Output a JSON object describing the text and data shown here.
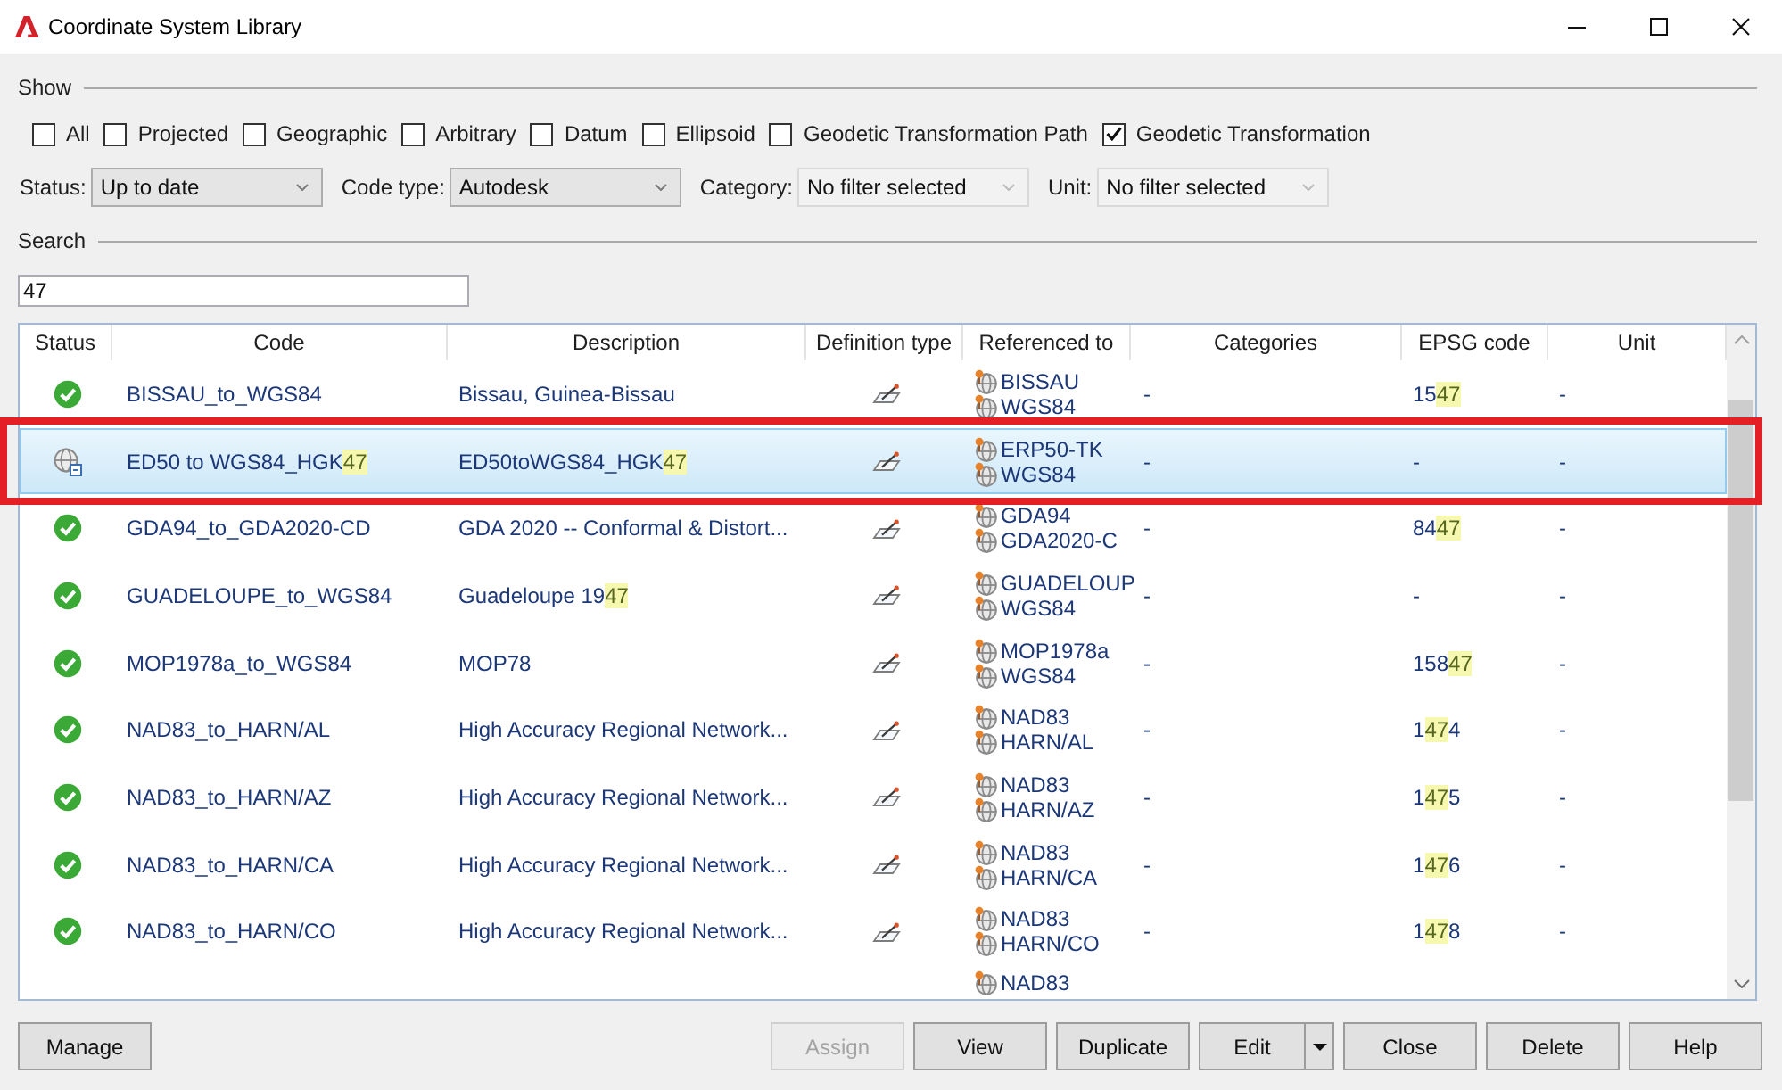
{
  "window": {
    "title": "Coordinate System Library"
  },
  "show": {
    "label": "Show",
    "options": [
      {
        "label": "All",
        "checked": false
      },
      {
        "label": "Projected",
        "checked": false
      },
      {
        "label": "Geographic",
        "checked": false
      },
      {
        "label": "Arbitrary",
        "checked": false
      },
      {
        "label": "Datum",
        "checked": false
      },
      {
        "label": "Ellipsoid",
        "checked": false
      },
      {
        "label": "Geodetic Transformation Path",
        "checked": false
      },
      {
        "label": "Geodetic Transformation",
        "checked": true
      }
    ]
  },
  "filters": [
    {
      "label": "Status:",
      "value": "Up to date",
      "disabled": false
    },
    {
      "label": "Code type:",
      "value": "Autodesk",
      "disabled": false
    },
    {
      "label": "Category:",
      "value": "No filter selected",
      "disabled": true
    },
    {
      "label": "Unit:",
      "value": "No filter selected",
      "disabled": true
    }
  ],
  "search": {
    "label": "Search",
    "value": "47"
  },
  "table": {
    "columns": [
      "Status",
      "Code",
      "Description",
      "Definition type",
      "Referenced to",
      "Categories",
      "EPSG code",
      "Unit"
    ],
    "rows": [
      {
        "status": {
          "kind": "valid"
        },
        "code": [
          {
            "text": "BISSAU_to_WGS84",
            "match": false
          }
        ],
        "description": [
          {
            "text": "Bissau, Guinea-Bissau",
            "match": false
          }
        ],
        "definition_type": {
          "kind": "transformation"
        },
        "referenced_to": [
          "BISSAU",
          "WGS84"
        ],
        "categories": "-",
        "epsg_code": [
          {
            "text": "15",
            "match": false
          },
          {
            "text": "47",
            "match": true
          }
        ],
        "unit": "-",
        "selected": false,
        "outlined": false
      },
      {
        "status": {
          "kind": "user"
        },
        "code": [
          {
            "text": "ED50 to WGS84_HGK",
            "match": false
          },
          {
            "text": "47",
            "match": true
          }
        ],
        "description": [
          {
            "text": "ED50toWGS84_HGK",
            "match": false
          },
          {
            "text": "47",
            "match": true
          }
        ],
        "definition_type": {
          "kind": "transformation"
        },
        "referenced_to": [
          "ERP50-TK",
          "WGS84"
        ],
        "categories": "-",
        "epsg_code": [
          {
            "text": "-",
            "match": false
          }
        ],
        "unit": "-",
        "selected": true,
        "outlined": true
      },
      {
        "status": {
          "kind": "valid"
        },
        "code": [
          {
            "text": "GDA94_to_GDA2020-CD",
            "match": false
          }
        ],
        "description": [
          {
            "text": "GDA 2020 -- Conformal & Distort...",
            "match": false
          }
        ],
        "definition_type": {
          "kind": "transformation"
        },
        "referenced_to": [
          "GDA94",
          "GDA2020-C"
        ],
        "categories": "-",
        "epsg_code": [
          {
            "text": "84",
            "match": false
          },
          {
            "text": "47",
            "match": true
          }
        ],
        "unit": "-",
        "selected": false,
        "outlined": false
      },
      {
        "status": {
          "kind": "valid"
        },
        "code": [
          {
            "text": "GUADELOUPE_to_WGS84",
            "match": false
          }
        ],
        "description": [
          {
            "text": "Guadeloupe 19",
            "match": false
          },
          {
            "text": "47",
            "match": true
          }
        ],
        "definition_type": {
          "kind": "transformation"
        },
        "referenced_to": [
          "GUADELOUP",
          "WGS84"
        ],
        "categories": "-",
        "epsg_code": [
          {
            "text": "-",
            "match": false
          }
        ],
        "unit": "-",
        "selected": false,
        "outlined": false
      },
      {
        "status": {
          "kind": "valid"
        },
        "code": [
          {
            "text": "MOP1978a_to_WGS84",
            "match": false
          }
        ],
        "description": [
          {
            "text": "MOP78",
            "match": false
          }
        ],
        "definition_type": {
          "kind": "transformation"
        },
        "referenced_to": [
          "MOP1978a",
          "WGS84"
        ],
        "categories": "-",
        "epsg_code": [
          {
            "text": "158",
            "match": false
          },
          {
            "text": "47",
            "match": true
          }
        ],
        "unit": "-",
        "selected": false,
        "outlined": false
      },
      {
        "status": {
          "kind": "valid"
        },
        "code": [
          {
            "text": "NAD83_to_HARN/AL",
            "match": false
          }
        ],
        "description": [
          {
            "text": "High Accuracy Regional Network...",
            "match": false
          }
        ],
        "definition_type": {
          "kind": "transformation"
        },
        "referenced_to": [
          "NAD83",
          "HARN/AL"
        ],
        "categories": "-",
        "epsg_code": [
          {
            "text": "1",
            "match": false
          },
          {
            "text": "47",
            "match": true
          },
          {
            "text": "4",
            "match": false
          }
        ],
        "unit": "-",
        "selected": false,
        "outlined": false
      },
      {
        "status": {
          "kind": "valid"
        },
        "code": [
          {
            "text": "NAD83_to_HARN/AZ",
            "match": false
          }
        ],
        "description": [
          {
            "text": "High Accuracy Regional Network...",
            "match": false
          }
        ],
        "definition_type": {
          "kind": "transformation"
        },
        "referenced_to": [
          "NAD83",
          "HARN/AZ"
        ],
        "categories": "-",
        "epsg_code": [
          {
            "text": "1",
            "match": false
          },
          {
            "text": "47",
            "match": true
          },
          {
            "text": "5",
            "match": false
          }
        ],
        "unit": "-",
        "selected": false,
        "outlined": false
      },
      {
        "status": {
          "kind": "valid"
        },
        "code": [
          {
            "text": "NAD83_to_HARN/CA",
            "match": false
          }
        ],
        "description": [
          {
            "text": "High Accuracy Regional Network...",
            "match": false
          }
        ],
        "definition_type": {
          "kind": "transformation"
        },
        "referenced_to": [
          "NAD83",
          "HARN/CA"
        ],
        "categories": "-",
        "epsg_code": [
          {
            "text": "1",
            "match": false
          },
          {
            "text": "47",
            "match": true
          },
          {
            "text": "6",
            "match": false
          }
        ],
        "unit": "-",
        "selected": false,
        "outlined": false
      },
      {
        "status": {
          "kind": "valid"
        },
        "code": [
          {
            "text": "NAD83_to_HARN/CO",
            "match": false
          }
        ],
        "description": [
          {
            "text": "High Accuracy Regional Network...",
            "match": false
          }
        ],
        "definition_type": {
          "kind": "transformation"
        },
        "referenced_to": [
          "NAD83",
          "HARN/CO"
        ],
        "categories": "-",
        "epsg_code": [
          {
            "text": "1",
            "match": false
          },
          {
            "text": "47",
            "match": true
          },
          {
            "text": "8",
            "match": false
          }
        ],
        "unit": "-",
        "selected": false,
        "outlined": false
      },
      {
        "referenced_to": [
          "NAD83"
        ],
        "selected": false,
        "outlined": false
      }
    ]
  },
  "footer": {
    "left": [
      {
        "label": "Manage",
        "kind": "plain",
        "disabled": false
      }
    ],
    "right": [
      {
        "label": "Assign",
        "kind": "plain",
        "disabled": true
      },
      {
        "label": "View",
        "kind": "plain",
        "disabled": false
      },
      {
        "label": "Duplicate",
        "kind": "plain",
        "disabled": false
      },
      {
        "label": "Edit",
        "kind": "split",
        "disabled": false
      },
      {
        "label": "Close",
        "kind": "plain",
        "disabled": false
      },
      {
        "label": "Delete",
        "kind": "plain",
        "disabled": false
      },
      {
        "label": "Help",
        "kind": "plain",
        "disabled": false
      }
    ]
  }
}
